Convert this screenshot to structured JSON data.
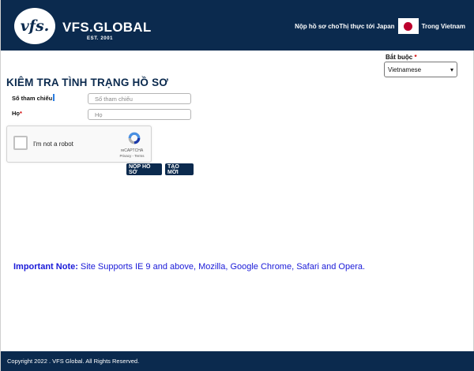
{
  "header": {
    "logo_mark": "vfs.",
    "brand": "VFS.GLOBAL",
    "brand_sub": "EST. 2001",
    "apply_text": "Nộp hồ sơ choThị thực tới Japan",
    "country_text": "Trong Vietnam",
    "flag_icon": "japan-flag-icon"
  },
  "language": {
    "label": "Bắt buộc",
    "required_mark": "*",
    "selected": "Vietnamese"
  },
  "form": {
    "title": "KIÊM TRA TÌNH TRẠNG HỒ SƠ",
    "reference_label": "Số tham chiếu",
    "reference_placeholder": "Số tham chiếu",
    "lastname_label": "Họ",
    "lastname_required": "*",
    "lastname_placeholder": "Họ"
  },
  "captcha": {
    "label": "I'm not a robot",
    "brand": "reCAPTCHA",
    "links": "Privacy - Terms",
    "icon": "recaptcha-icon"
  },
  "buttons": {
    "submit": "NỘP HỒ SƠ",
    "reset": "TẠO MỚI"
  },
  "note": {
    "label": "Important Note:",
    "text": "Site Supports IE 9 and above, Mozilla, Google Chrome, Safari and Opera."
  },
  "footer": {
    "copyright": "Copyright 2022 . VFS Global. All Rights Reserved."
  },
  "colors": {
    "header_bg": "#0b2a4e",
    "note_blue": "#1a1ad8",
    "required_red": "#d00000"
  }
}
